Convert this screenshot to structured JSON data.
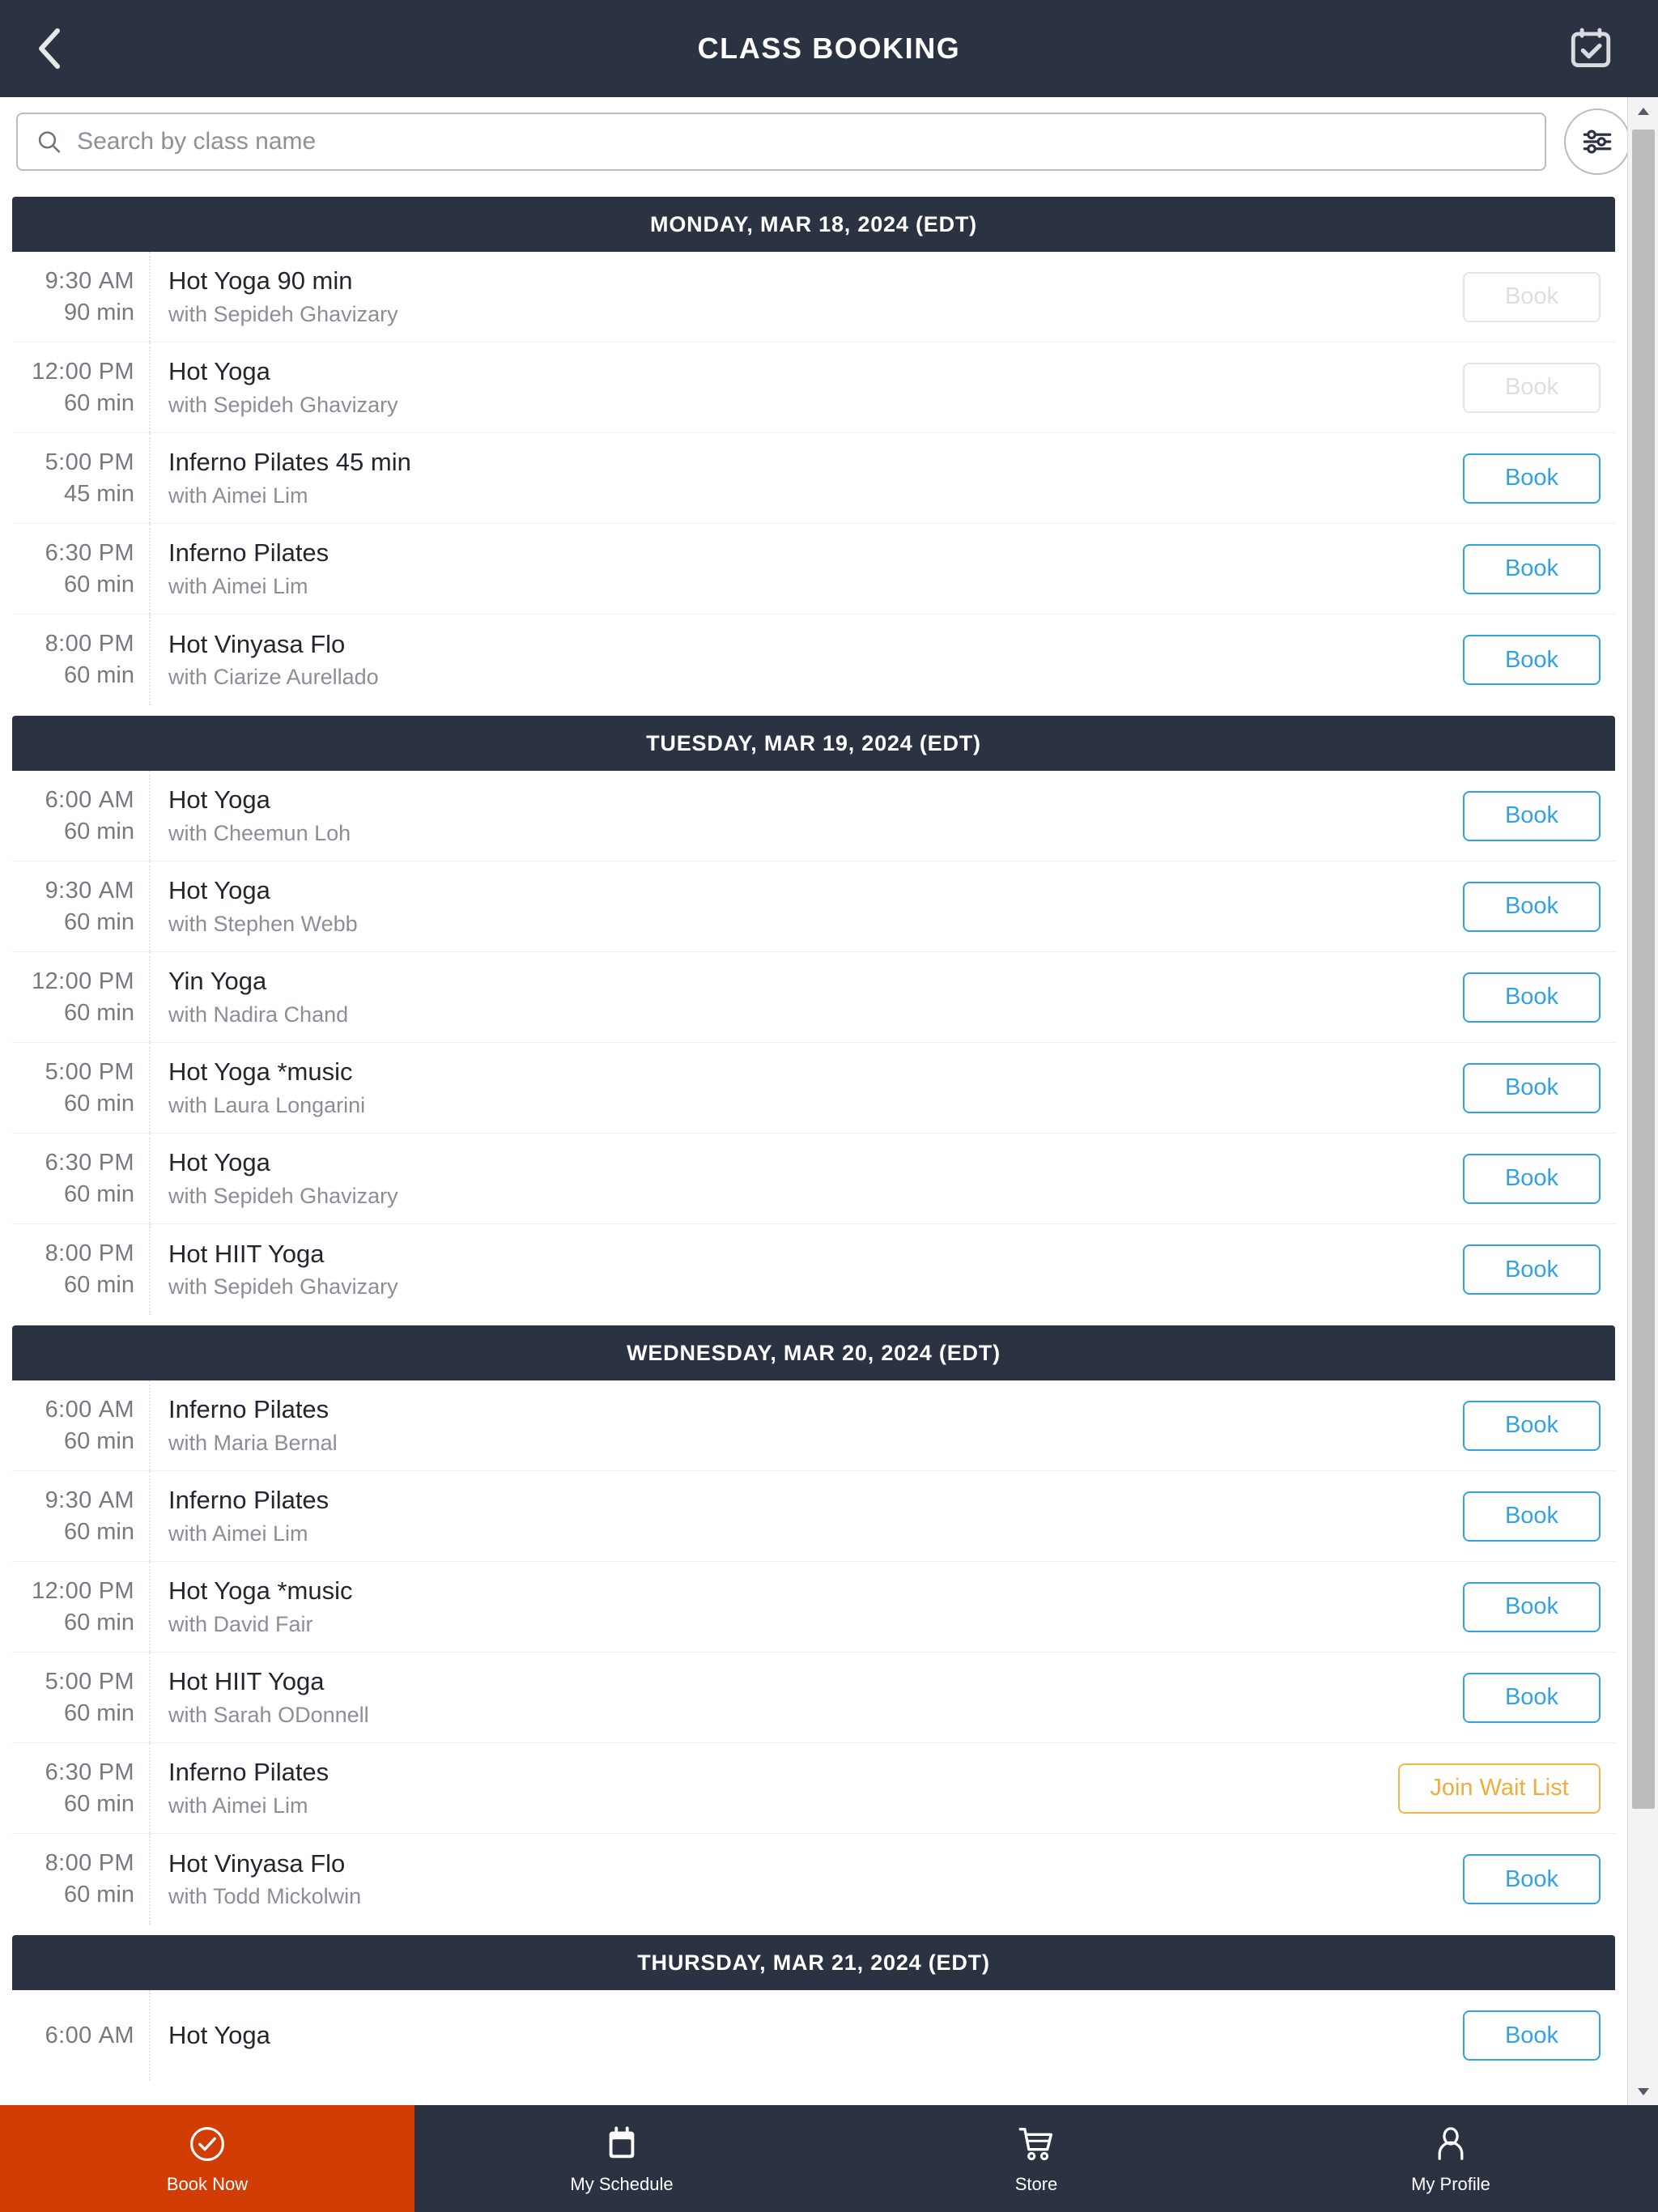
{
  "topbar": {
    "title": "CLASS BOOKING",
    "back_icon": "chevron-left-icon",
    "calendar_icon": "calendar-check-icon"
  },
  "search": {
    "placeholder": "Search by class name",
    "value": "",
    "search_icon": "search-icon",
    "filter_icon": "filter-sliders-icon"
  },
  "colors": {
    "header_navy": "#2b3241",
    "accent_blue": "#32a2e0",
    "waitlist_orange": "#f0ad3e",
    "active_tab_orange": "#d23c05",
    "disabled_grey": "#dcdee1"
  },
  "days": [
    {
      "header": "MONDAY, MAR 18, 2024 (EDT)",
      "classes": [
        {
          "time": "9:30",
          "ampm": "AM",
          "duration": "90 min",
          "name": "Hot Yoga 90 min",
          "teacher": "with Sepideh Ghavizary",
          "action": "Book",
          "state": "disabled"
        },
        {
          "time": "12:00",
          "ampm": "PM",
          "duration": "60 min",
          "name": "Hot Yoga",
          "teacher": "with Sepideh Ghavizary",
          "action": "Book",
          "state": "disabled"
        },
        {
          "time": "5:00",
          "ampm": "PM",
          "duration": "45 min",
          "name": "Inferno Pilates 45 min",
          "teacher": "with Aimei Lim",
          "action": "Book",
          "state": "book"
        },
        {
          "time": "6:30",
          "ampm": "PM",
          "duration": "60 min",
          "name": "Inferno Pilates",
          "teacher": "with Aimei Lim",
          "action": "Book",
          "state": "book"
        },
        {
          "time": "8:00",
          "ampm": "PM",
          "duration": "60 min",
          "name": "Hot Vinyasa Flo",
          "teacher": "with Ciarize Aurellado",
          "action": "Book",
          "state": "book"
        }
      ]
    },
    {
      "header": "TUESDAY, MAR 19, 2024 (EDT)",
      "classes": [
        {
          "time": "6:00",
          "ampm": "AM",
          "duration": "60 min",
          "name": "Hot Yoga",
          "teacher": "with Cheemun Loh",
          "action": "Book",
          "state": "book"
        },
        {
          "time": "9:30",
          "ampm": "AM",
          "duration": "60 min",
          "name": "Hot Yoga",
          "teacher": "with Stephen Webb",
          "action": "Book",
          "state": "book"
        },
        {
          "time": "12:00",
          "ampm": "PM",
          "duration": "60 min",
          "name": "Yin Yoga",
          "teacher": "with Nadira Chand",
          "action": "Book",
          "state": "book"
        },
        {
          "time": "5:00",
          "ampm": "PM",
          "duration": "60 min",
          "name": "Hot Yoga *music",
          "teacher": "with Laura Longarini",
          "action": "Book",
          "state": "book"
        },
        {
          "time": "6:30",
          "ampm": "PM",
          "duration": "60 min",
          "name": "Hot Yoga",
          "teacher": "with Sepideh Ghavizary",
          "action": "Book",
          "state": "book"
        },
        {
          "time": "8:00",
          "ampm": "PM",
          "duration": "60 min",
          "name": "Hot HIIT Yoga",
          "teacher": "with Sepideh Ghavizary",
          "action": "Book",
          "state": "book"
        }
      ]
    },
    {
      "header": "WEDNESDAY, MAR 20, 2024 (EDT)",
      "classes": [
        {
          "time": "6:00",
          "ampm": "AM",
          "duration": "60 min",
          "name": "Inferno Pilates",
          "teacher": "with Maria Bernal",
          "action": "Book",
          "state": "book"
        },
        {
          "time": "9:30",
          "ampm": "AM",
          "duration": "60 min",
          "name": "Inferno Pilates",
          "teacher": "with Aimei Lim",
          "action": "Book",
          "state": "book"
        },
        {
          "time": "12:00",
          "ampm": "PM",
          "duration": "60 min",
          "name": "Hot Yoga *music",
          "teacher": "with David Fair",
          "action": "Book",
          "state": "book"
        },
        {
          "time": "5:00",
          "ampm": "PM",
          "duration": "60 min",
          "name": "Hot HIIT Yoga",
          "teacher": "with Sarah ODonnell",
          "action": "Book",
          "state": "book"
        },
        {
          "time": "6:30",
          "ampm": "PM",
          "duration": "60 min",
          "name": "Inferno Pilates",
          "teacher": "with Aimei Lim",
          "action": "Join Wait List",
          "state": "waitlist"
        },
        {
          "time": "8:00",
          "ampm": "PM",
          "duration": "60 min",
          "name": "Hot Vinyasa Flo",
          "teacher": "with Todd Mickolwin",
          "action": "Book",
          "state": "book"
        }
      ]
    },
    {
      "header": "THURSDAY, MAR 21, 2024 (EDT)",
      "classes": [
        {
          "time": "6:00",
          "ampm": "AM",
          "duration": "",
          "name": "Hot Yoga",
          "teacher": "",
          "action": "Book",
          "state": "book"
        }
      ]
    }
  ],
  "bottomnav": [
    {
      "label": "Book Now",
      "icon": "check-circle-icon",
      "active": true
    },
    {
      "label": "My Schedule",
      "icon": "calendar-icon",
      "active": false
    },
    {
      "label": "Store",
      "icon": "shopping-cart-icon",
      "active": false
    },
    {
      "label": "My Profile",
      "icon": "user-icon",
      "active": false
    }
  ]
}
